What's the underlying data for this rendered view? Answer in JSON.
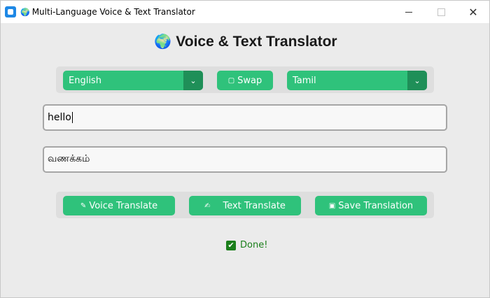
{
  "window": {
    "title": "Multi-Language Voice & Text Translator",
    "title_icon": "globe",
    "controls": [
      "minimize",
      "maximize",
      "close"
    ],
    "close_glyph": "✕"
  },
  "header": {
    "title": "Voice & Text Translator",
    "icon": "globe"
  },
  "languages": {
    "source": "English",
    "target": "Tamil",
    "swap_label": "Swap",
    "arrow": "⌄"
  },
  "input": {
    "value": "hello"
  },
  "output": {
    "value": "வணக்கம்"
  },
  "actions": {
    "voice_label": "Voice Translate",
    "text_label": "Text Translate",
    "save_label": "Save Translation"
  },
  "status": {
    "text": "Done!",
    "icon": "check"
  },
  "colors": {
    "accent": "#2fc27b",
    "accent_dark": "#1f8f58",
    "status": "#1b7f1b",
    "background": "#ebebeb"
  }
}
